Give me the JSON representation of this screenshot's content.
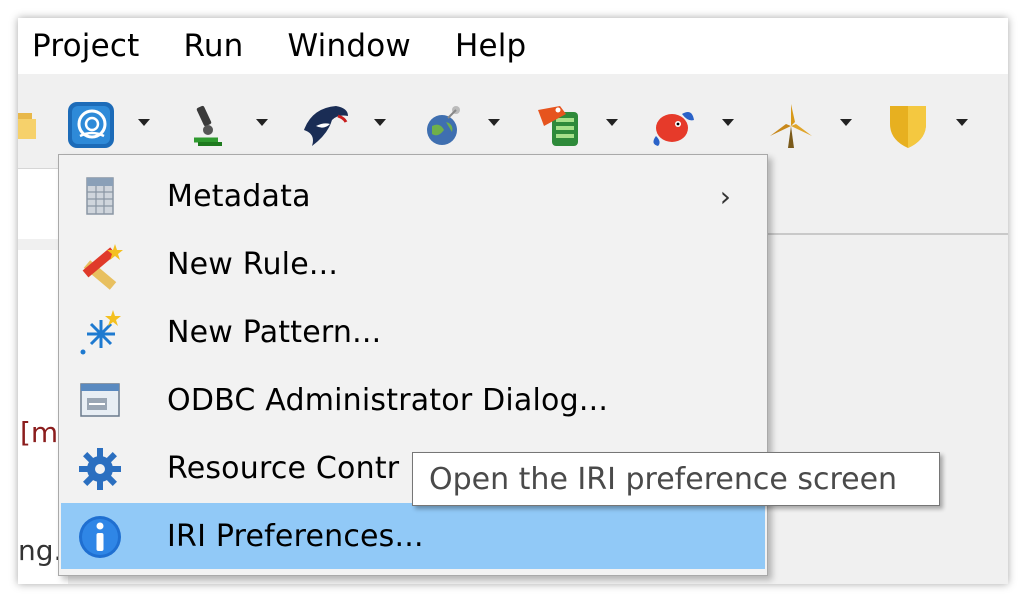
{
  "menubar": {
    "items": [
      {
        "label": "Project"
      },
      {
        "label": "Run"
      },
      {
        "label": "Window"
      },
      {
        "label": "Help"
      }
    ]
  },
  "toolbar": {
    "icons": [
      "folder-icon",
      "data-quality-icon",
      "microscope-icon",
      "orca-icon",
      "globe-satellite-icon",
      "database-tag-icon",
      "fish-icon",
      "windmill-icon",
      "shield-icon"
    ]
  },
  "background": {
    "frag1": "[m",
    "frag2": "ng."
  },
  "menu": {
    "items": [
      {
        "label": "Metadata",
        "icon": "table-icon",
        "submenu": "›"
      },
      {
        "label": "New Rule...",
        "icon": "pencil-ruler-icon"
      },
      {
        "label": "New Pattern...",
        "icon": "sparkle-wand-icon"
      },
      {
        "label": "ODBC Administrator Dialog...",
        "icon": "odbc-window-icon"
      },
      {
        "label": "Resource Contr",
        "icon": "gear-icon"
      },
      {
        "label": "IRI Preferences...",
        "icon": "info-icon",
        "selected": true
      }
    ]
  },
  "tooltip": {
    "text": "Open the IRI preference screen"
  },
  "colors": {
    "selection": "#91c9f7",
    "menu_bg": "#f2f2f2",
    "info_blue": "#1f6fd1"
  }
}
